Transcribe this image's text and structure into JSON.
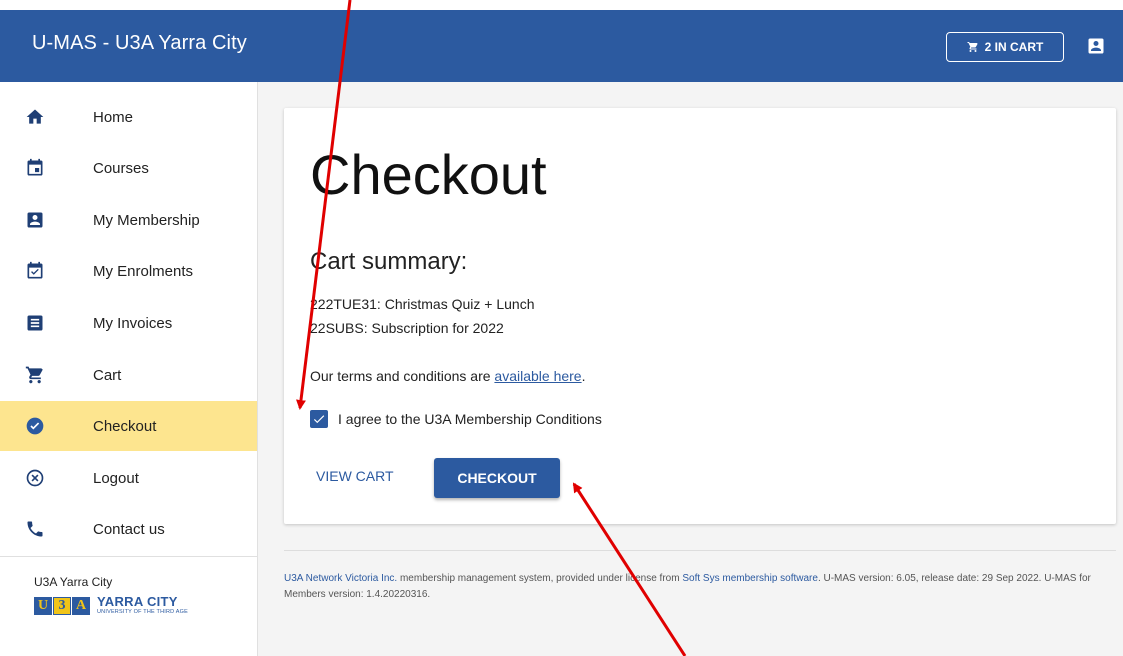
{
  "header": {
    "app_title": "U-MAS - U3A Yarra City",
    "cart_label": "2 IN CART"
  },
  "sidebar": {
    "items": [
      {
        "label": "Home",
        "icon": "home-icon"
      },
      {
        "label": "Courses",
        "icon": "calendar-icon"
      },
      {
        "label": "My Membership",
        "icon": "account-box-icon"
      },
      {
        "label": "My Enrolments",
        "icon": "calendar-check-icon"
      },
      {
        "label": "My Invoices",
        "icon": "receipt-icon"
      },
      {
        "label": "Cart",
        "icon": "cart-icon"
      },
      {
        "label": "Checkout",
        "icon": "check-circle-icon"
      },
      {
        "label": "Logout",
        "icon": "close-circle-icon"
      },
      {
        "label": "Contact us",
        "icon": "phone-icon"
      }
    ],
    "active": "Checkout",
    "org_name": "U3A Yarra City",
    "logo": {
      "letters": [
        "U",
        "3",
        "A"
      ],
      "name": "YARRA CITY",
      "tagline": "UNIVERSITY OF THE THIRD AGE"
    }
  },
  "main": {
    "title": "Checkout",
    "summary_title": "Cart summary:",
    "cart_lines": [
      "222TUE31: Christmas Quiz + Lunch",
      "22SUBS: Subscription for 2022"
    ],
    "terms_prefix": "Our terms and conditions are ",
    "terms_link": "available here",
    "terms_suffix": ".",
    "agree_label": "I agree to the U3A Membership Conditions",
    "agree_checked": true,
    "view_cart_label": "VIEW CART",
    "checkout_label": "CHECKOUT"
  },
  "footer": {
    "org_link": "U3A Network Victoria Inc.",
    "text_mid": " membership management system, provided under license from ",
    "vendor_link": "Soft Sys membership software",
    "text_end": ". U-MAS version: 6.05, release date: 29 Sep 2022. U-MAS for Members version: 1.4.20220316."
  },
  "colors": {
    "primary": "#2c5aa0",
    "active_bg": "#fde58f",
    "annotation_arrow": "#e00000"
  }
}
